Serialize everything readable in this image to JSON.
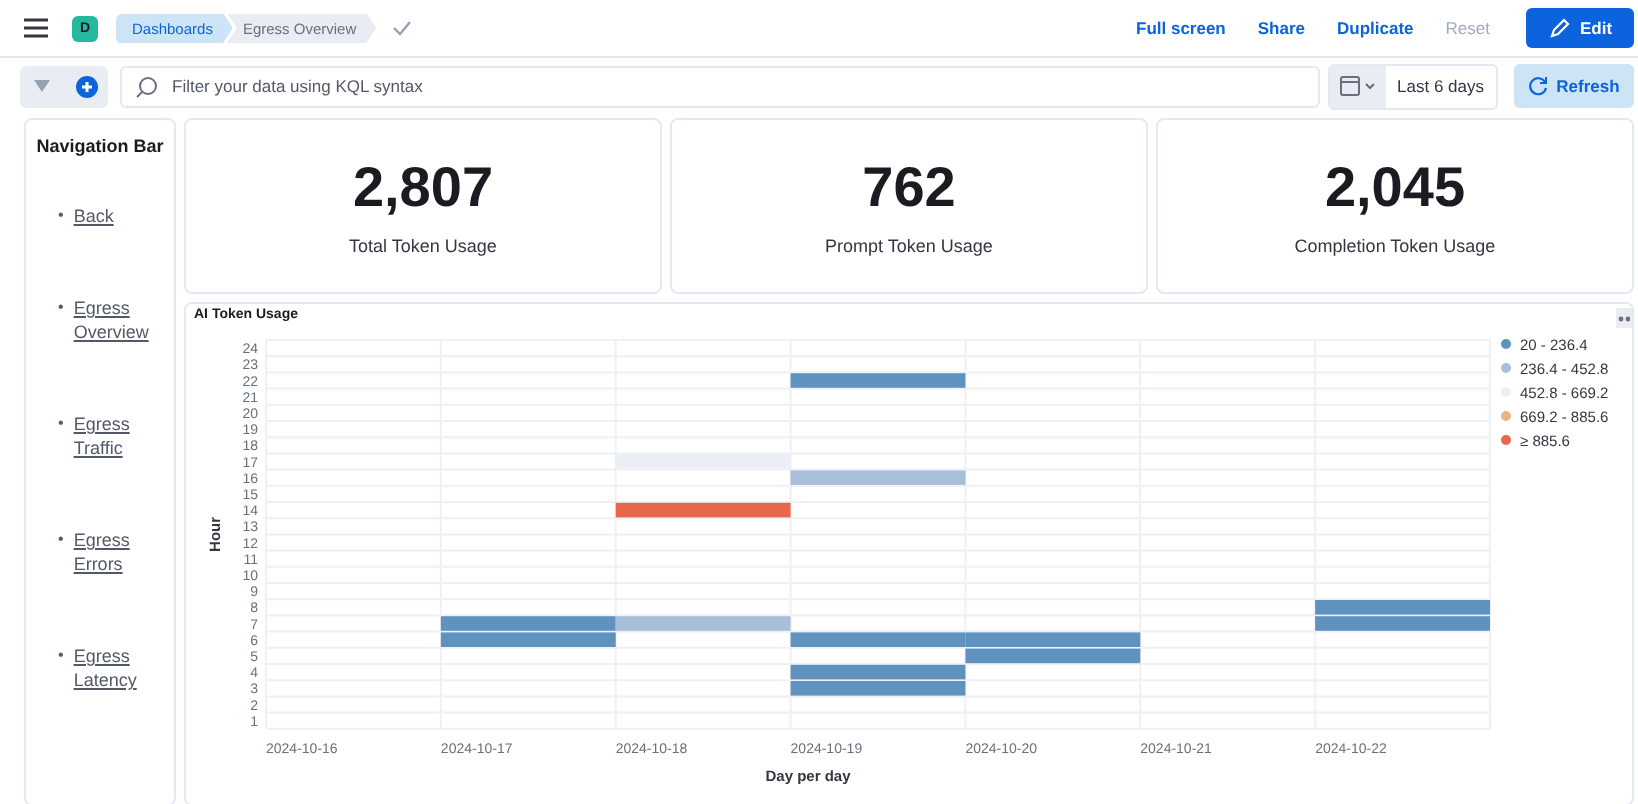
{
  "header": {
    "space_avatar": "D",
    "breadcrumbs": [
      {
        "label": "Dashboards",
        "selected": false
      },
      {
        "label": "Egress Overview",
        "selected": true
      }
    ],
    "actions": [
      {
        "label": "Full screen",
        "disabled": false
      },
      {
        "label": "Share",
        "disabled": false
      },
      {
        "label": "Duplicate",
        "disabled": false
      },
      {
        "label": "Reset",
        "disabled": true
      }
    ],
    "edit_button": "Edit"
  },
  "query_bar": {
    "placeholder": "Filter your data using KQL syntax",
    "date_range": "Last 6 days",
    "refresh_button": "Refresh"
  },
  "sidebar": {
    "title": "Navigation Bar",
    "bullet": "•",
    "links": [
      "Back",
      "Egress Overview",
      "Egress Traffic",
      "Egress Errors",
      "Egress Latency"
    ]
  },
  "metrics": [
    {
      "value": "2,807",
      "label": "Total Token Usage"
    },
    {
      "value": "762",
      "label": "Prompt Token Usage"
    },
    {
      "value": "2,045",
      "label": "Completion Token Usage"
    }
  ],
  "heatmap": {
    "title": "AI Token Usage",
    "xlabel": "Day per day",
    "ylabel": "Hour",
    "days": [
      "2024-10-16",
      "2024-10-17",
      "2024-10-18",
      "2024-10-19",
      "2024-10-20",
      "2024-10-21",
      "2024-10-22"
    ],
    "legend": [
      {
        "label": "20 - 236.4",
        "color": "#6092c0"
      },
      {
        "label": "236.4 - 452.8",
        "color": "#a8bfda"
      },
      {
        "label": "452.8 - 669.2",
        "color": "#ebeff5"
      },
      {
        "label": "669.2 - 885.6",
        "color": "#ecb385"
      },
      {
        "label": "≥ 885.6",
        "color": "#e7664c"
      }
    ],
    "rows": [
      {
        "hour": "24",
        "cells": [
          null,
          null,
          null,
          null,
          null,
          null,
          null
        ]
      },
      {
        "hour": "23",
        "cells": [
          null,
          null,
          null,
          null,
          null,
          null,
          null
        ]
      },
      {
        "hour": "22",
        "cells": [
          null,
          null,
          null,
          {
            "color": "#6092c0"
          },
          null,
          null,
          null
        ]
      },
      {
        "hour": "21",
        "cells": [
          null,
          null,
          null,
          null,
          null,
          null,
          null
        ]
      },
      {
        "hour": "20",
        "cells": [
          null,
          null,
          null,
          null,
          null,
          null,
          null
        ]
      },
      {
        "hour": "19",
        "cells": [
          null,
          null,
          null,
          null,
          null,
          null,
          null
        ]
      },
      {
        "hour": "18",
        "cells": [
          null,
          null,
          null,
          null,
          null,
          null,
          null
        ]
      },
      {
        "hour": "17",
        "cells": [
          null,
          null,
          {
            "color": "#ebeff5"
          },
          null,
          null,
          null,
          null
        ]
      },
      {
        "hour": "16",
        "cells": [
          null,
          null,
          null,
          {
            "color": "#a8bfda"
          },
          null,
          null,
          null
        ]
      },
      {
        "hour": "15",
        "cells": [
          null,
          null,
          null,
          null,
          null,
          null,
          null
        ]
      },
      {
        "hour": "14",
        "cells": [
          null,
          null,
          {
            "color": "#e7664c"
          },
          null,
          null,
          null,
          null
        ]
      },
      {
        "hour": "13",
        "cells": [
          null,
          null,
          null,
          null,
          null,
          null,
          null
        ]
      },
      {
        "hour": "12",
        "cells": [
          null,
          null,
          null,
          null,
          null,
          null,
          null
        ]
      },
      {
        "hour": "11",
        "cells": [
          null,
          null,
          null,
          null,
          null,
          null,
          null
        ]
      },
      {
        "hour": "10",
        "cells": [
          null,
          null,
          null,
          null,
          null,
          null,
          null
        ]
      },
      {
        "hour": "9",
        "cells": [
          null,
          null,
          null,
          null,
          null,
          null,
          null
        ]
      },
      {
        "hour": "8",
        "cells": [
          null,
          null,
          null,
          null,
          null,
          null,
          {
            "color": "#6092c0"
          }
        ]
      },
      {
        "hour": "7",
        "cells": [
          null,
          {
            "color": "#6092c0"
          },
          {
            "color": "#a8bfda"
          },
          null,
          null,
          null,
          {
            "color": "#6092c0"
          }
        ]
      },
      {
        "hour": "6",
        "cells": [
          null,
          {
            "color": "#6092c0"
          },
          null,
          {
            "color": "#6092c0"
          },
          {
            "color": "#6092c0"
          },
          null,
          null
        ]
      },
      {
        "hour": "5",
        "cells": [
          null,
          null,
          null,
          null,
          {
            "color": "#6092c0"
          },
          null,
          null
        ]
      },
      {
        "hour": "4",
        "cells": [
          null,
          null,
          null,
          {
            "color": "#6092c0"
          },
          null,
          null,
          null
        ]
      },
      {
        "hour": "3",
        "cells": [
          null,
          null,
          null,
          {
            "color": "#6092c0"
          },
          null,
          null,
          null
        ]
      },
      {
        "hour": "2",
        "cells": [
          null,
          null,
          null,
          null,
          null,
          null,
          null
        ]
      },
      {
        "hour": "1",
        "cells": [
          null,
          null,
          null,
          null,
          null,
          null,
          null
        ]
      }
    ]
  }
}
